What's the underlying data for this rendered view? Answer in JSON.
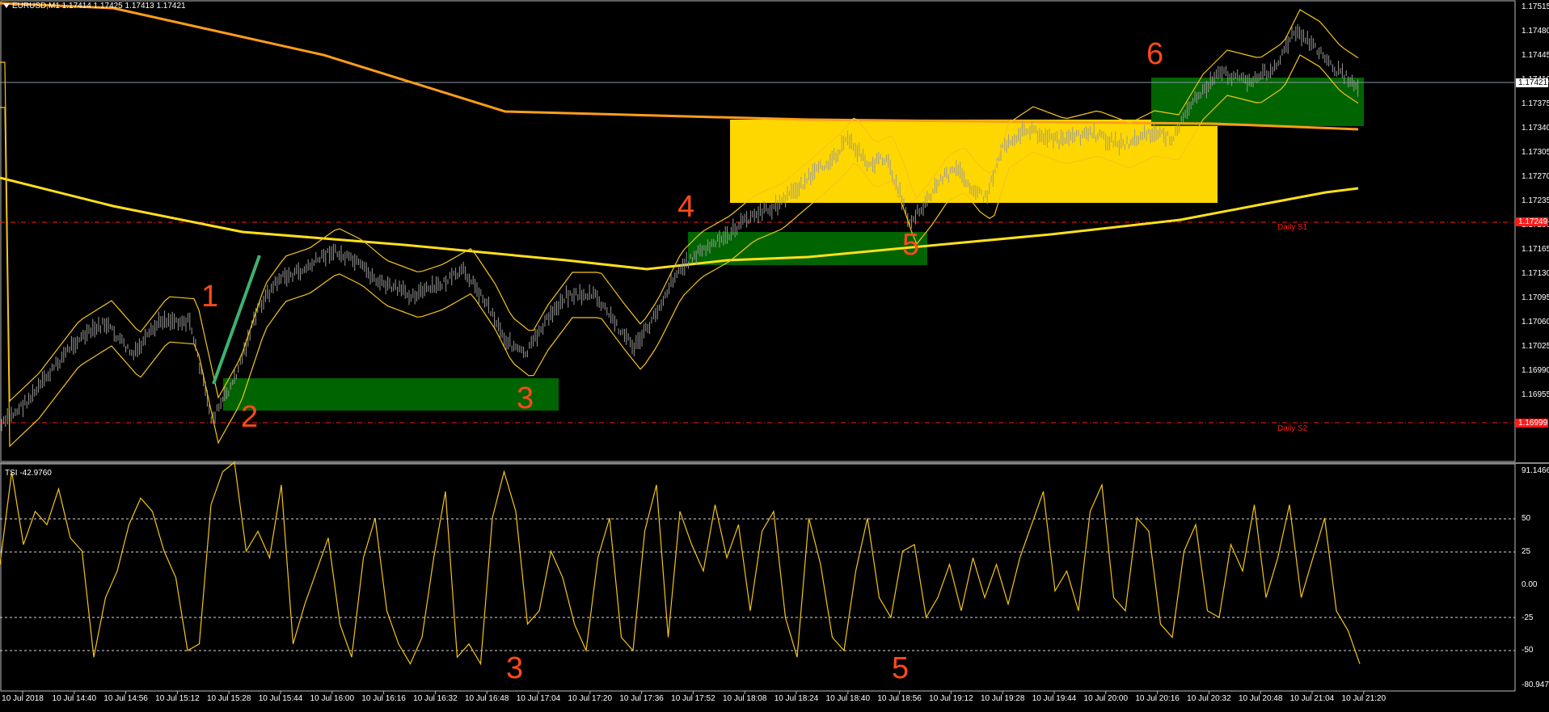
{
  "window": {
    "symbol_header": "EURUSD,M1  1.17414 1.17425 1.17413 1.17421",
    "indicator_header": "TSI -42.9760"
  },
  "price_axis": {
    "labels": [
      "1.17515",
      "1.17480",
      "1.17445",
      "1.17410",
      "1.17375",
      "1.17340",
      "1.17305",
      "1.17270",
      "1.17235",
      "1.17200",
      "1.17165",
      "1.17130",
      "1.17095",
      "1.17060",
      "1.17025",
      "1.16990",
      "1.16955"
    ],
    "current_price": "1.17421",
    "level_s1_price": "1.17249",
    "level_s2_price": "1.16999"
  },
  "tsi_axis": {
    "labels": [
      "91.1466",
      "50",
      "25",
      "0.00",
      "-25",
      "-50",
      "-80.9477"
    ]
  },
  "time_axis": {
    "labels": [
      "10 Jul 2018",
      "10 Jul 14:40",
      "10 Jul 14:56",
      "10 Jul 15:12",
      "10 Jul 15:28",
      "10 Jul 15:44",
      "10 Jul 16:00",
      "10 Jul 16:16",
      "10 Jul 16:32",
      "10 Jul 16:48",
      "10 Jul 17:04",
      "10 Jul 17:20",
      "10 Jul 17:36",
      "10 Jul 17:52",
      "10 Jul 18:08",
      "10 Jul 18:24",
      "10 Jul 18:40",
      "10 Jul 18:56",
      "10 Jul 19:12",
      "10 Jul 19:28",
      "10 Jul 19:44",
      "10 Jul 20:00",
      "10 Jul 20:16",
      "10 Jul 20:32",
      "10 Jul 20:48",
      "10 Jul 21:04",
      "10 Jul 21:20"
    ]
  },
  "levels": {
    "s1_label": "Daily S1",
    "s2_label": "Daily S2"
  },
  "annotations": {
    "m1": "1",
    "m2": "2",
    "m3": "3",
    "m4": "4",
    "m5": "5",
    "m6": "6",
    "tsi_m3": "3",
    "tsi_m5": "5"
  },
  "colors": {
    "background": "#000000",
    "candles": "#9a9a9a",
    "envelope": "#f5c518",
    "ma_slow": "#ff9d1a",
    "ma_mid": "#ffe01a",
    "zone_green": "#006400",
    "zone_yellow": "#ffd700",
    "level_red": "#ff1a1a",
    "tsi_line": "#f5c518",
    "marker": "#ff4a1a",
    "trend_line": "#3cb371"
  }
}
